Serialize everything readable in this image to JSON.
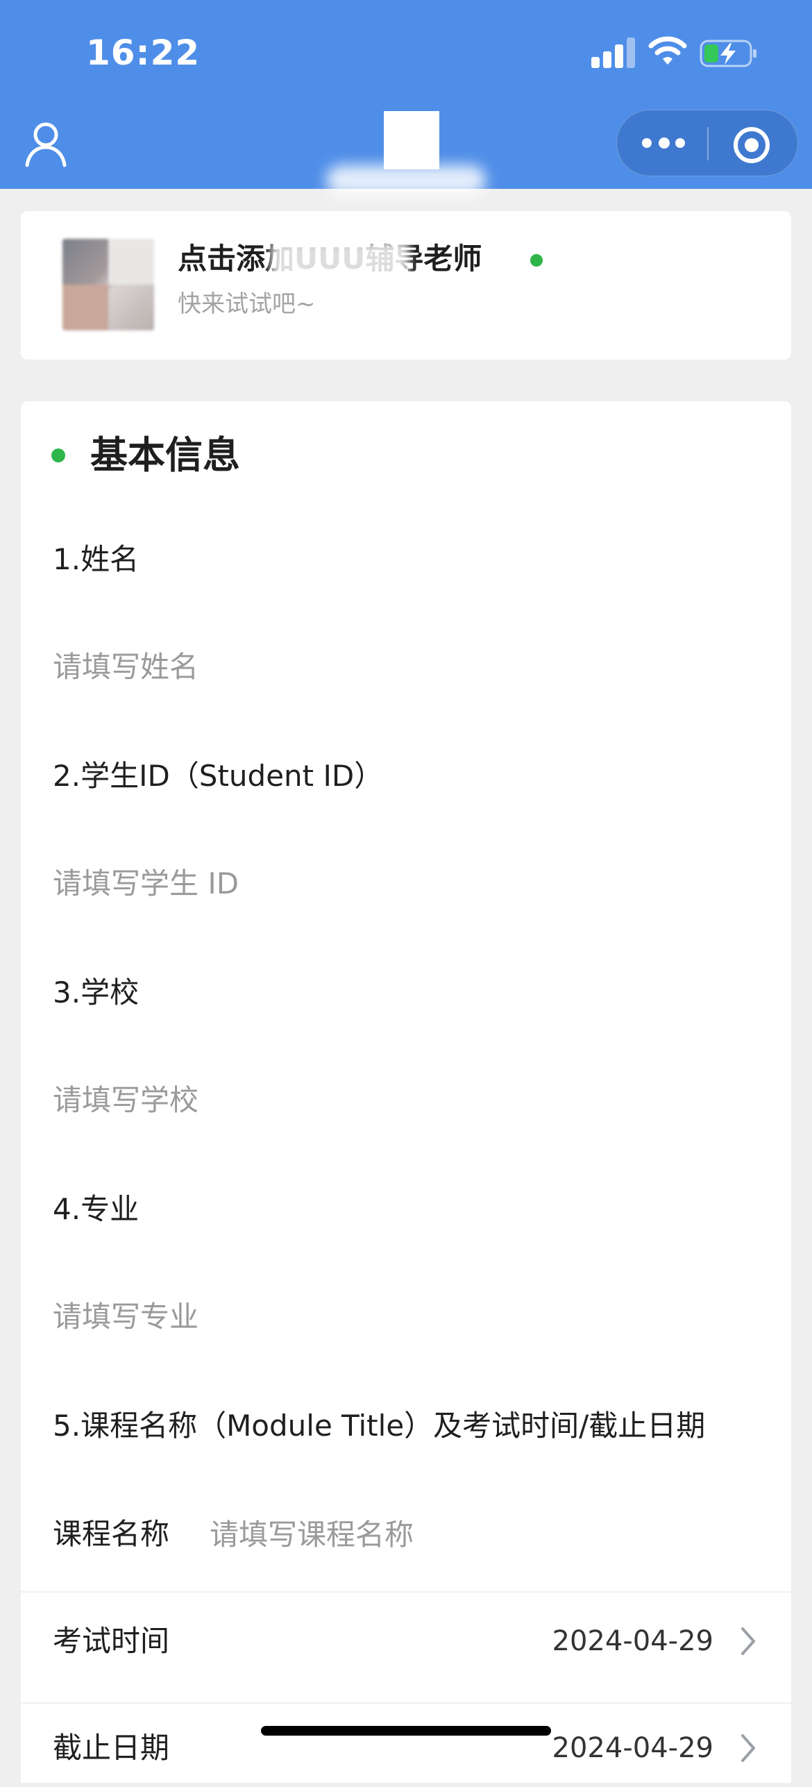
{
  "status_bar": {
    "time": "16:22"
  },
  "tutor": {
    "name": "点击添加UUU辅导老师",
    "subtitle": "快来试试吧~"
  },
  "form": {
    "section_title": "基本信息",
    "questions": [
      {
        "label": "1.姓名",
        "placeholder": "请填写姓名"
      },
      {
        "label": "2.学生ID（Student ID）",
        "placeholder": "请填写学生 ID"
      },
      {
        "label": "3.学校",
        "placeholder": "请填写学校"
      },
      {
        "label": "4.专业",
        "placeholder": "请填写专业"
      }
    ],
    "q5_label": "5.课程名称（Module Title）及考试时间/截止日期",
    "course": {
      "label": "课程名称",
      "placeholder": "请填写课程名称"
    },
    "exam_time": {
      "label": "考试时间",
      "value": "2024-04-29"
    },
    "deadline": {
      "label": "截止日期",
      "value": "2024-04-29"
    }
  },
  "colors": {
    "header_blue": "#4f8ee8",
    "online_green": "#2fb54a",
    "placeholder_gray": "#9a9a9a"
  },
  "icons": [
    "profile-icon",
    "more-icon",
    "target-icon",
    "chevron-right-icon",
    "wifi-icon",
    "battery-charging-icon",
    "signal-icon"
  ]
}
